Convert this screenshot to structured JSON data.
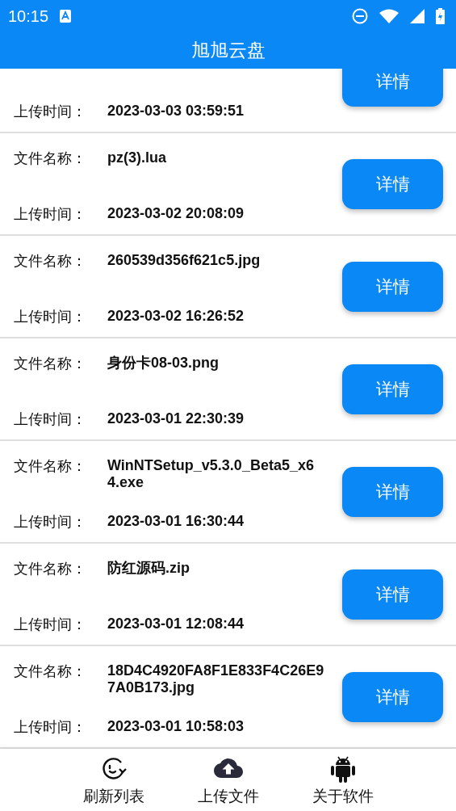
{
  "status_bar": {
    "time": "10:15"
  },
  "app_bar": {
    "title": "旭旭云盘"
  },
  "files": [
    {
      "time_label": "上传时间：",
      "time": "2023-03-03 03:59:51",
      "button": "详情",
      "partial": true
    },
    {
      "name_label": "文件名称：",
      "name": "pz(3).lua",
      "time_label": "上传时间：",
      "time": "2023-03-02 20:08:09",
      "button": "详情",
      "partial": false
    },
    {
      "name_label": "文件名称：",
      "name": "260539d356f621c5.jpg",
      "time_label": "上传时间：",
      "time": "2023-03-02 16:26:52",
      "button": "详情",
      "partial": false
    },
    {
      "name_label": "文件名称：",
      "name": "身份卡08-03.png",
      "time_label": "上传时间：",
      "time": "2023-03-01 22:30:39",
      "button": "详情",
      "partial": false
    },
    {
      "name_label": "文件名称：",
      "name": "WinNTSetup_v5.3.0_Beta5_x64.exe",
      "time_label": "上传时间：",
      "time": "2023-03-01 16:30:44",
      "button": "详情",
      "partial": false
    },
    {
      "name_label": "文件名称：",
      "name": "防红源码.zip",
      "time_label": "上传时间：",
      "time": "2023-03-01 12:08:44",
      "button": "详情",
      "partial": false
    },
    {
      "name_label": "文件名称：",
      "name": "18D4C4920FA8F1E833F4C26E97A0B173.jpg",
      "time_label": "上传时间：",
      "time": "2023-03-01 10:58:03",
      "button": "详情",
      "partial": false
    }
  ],
  "bottom_nav": [
    {
      "kind": "refresh",
      "label": "刷新列表"
    },
    {
      "kind": "upload",
      "label": "上传文件"
    },
    {
      "kind": "about",
      "label": "关于软件"
    }
  ]
}
